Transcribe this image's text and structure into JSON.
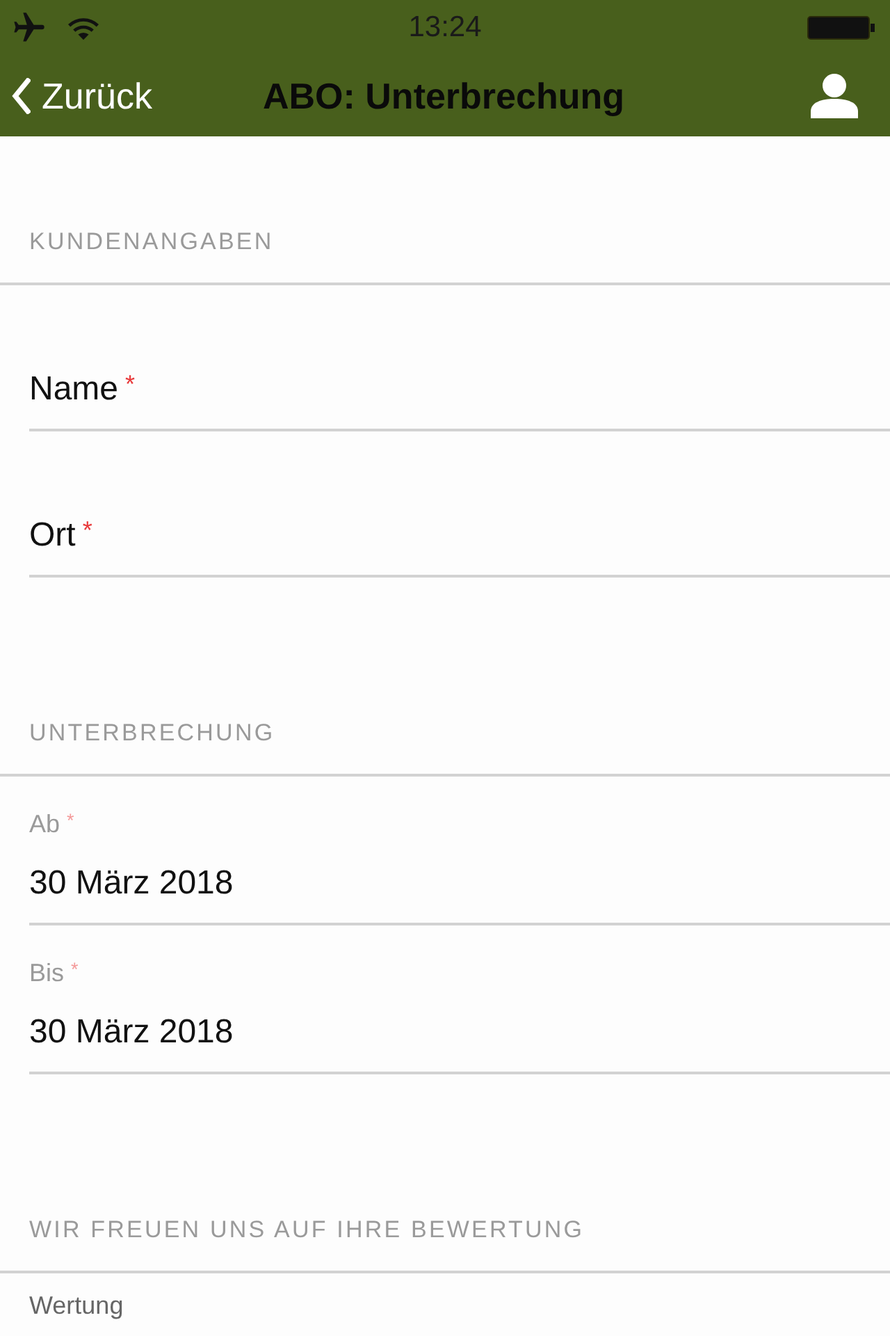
{
  "status_bar": {
    "time": "13:24"
  },
  "nav_bar": {
    "back_label": "Zurück",
    "title": "ABO: Unterbrechung"
  },
  "sections": [
    {
      "title": "KUNDENANGABEN",
      "fields": [
        {
          "kind": "text",
          "label": "Name",
          "required_mark": "*"
        },
        {
          "kind": "text",
          "label": "Ort",
          "required_mark": "*"
        }
      ]
    },
    {
      "title": "UNTERBRECHUNG",
      "fields": [
        {
          "kind": "date",
          "label": "Ab",
          "required_mark": "*",
          "value": "30 März 2018"
        },
        {
          "kind": "date",
          "label": "Bis",
          "required_mark": "*",
          "value": "30 März 2018"
        }
      ]
    },
    {
      "title": "WIR FREUEN UNS AUF IHRE BEWERTUNG",
      "fields": [
        {
          "kind": "rating",
          "label": "Wertung"
        }
      ]
    }
  ]
}
